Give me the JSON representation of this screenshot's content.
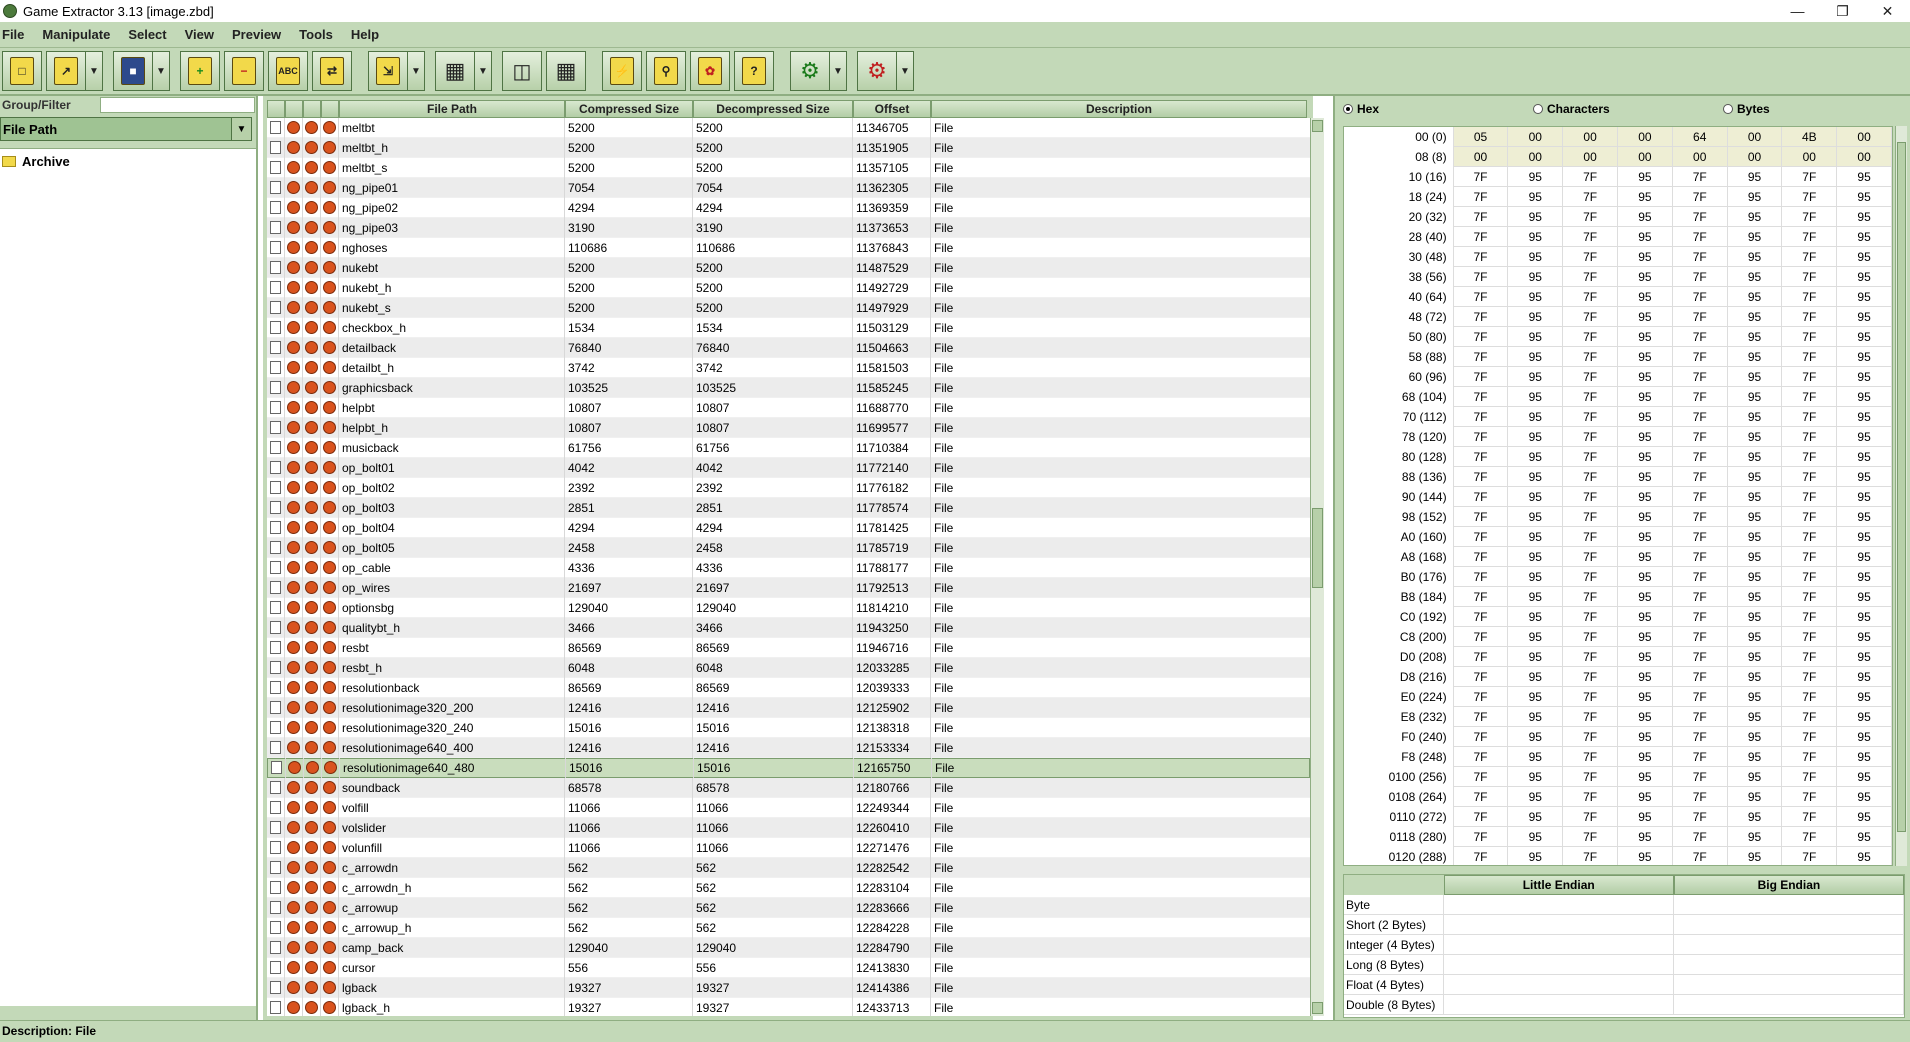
{
  "window": {
    "title": "Game Extractor 3.13 [image.zbd]"
  },
  "menu": [
    "File",
    "Manipulate",
    "Select",
    "View",
    "Preview",
    "Tools",
    "Help"
  ],
  "toolbar_icons": [
    "new-archive-icon",
    "open-archive-icon",
    "save-archive-icon",
    "add-files-icon",
    "remove-files-icon",
    "rename-files-icon",
    "write-archive-icon",
    "extract-icon",
    "table-view-icon",
    "thumbnail-view-icon",
    "details-view-icon",
    "scripts-icon",
    "search-icon",
    "plugins-icon",
    "help-icon",
    "tools-icon",
    "options-icon"
  ],
  "filter": {
    "label": "Group/Filter Type",
    "value": "File Path"
  },
  "tree": {
    "root": "Archive"
  },
  "table": {
    "columns": {
      "path": "File Path",
      "compressed": "Compressed Size",
      "decompressed": "Decompressed Size",
      "offset": "Offset",
      "description": "Description"
    },
    "rows": [
      [
        "meltbt",
        "5200",
        "5200",
        "11346705",
        "File"
      ],
      [
        "meltbt_h",
        "5200",
        "5200",
        "11351905",
        "File"
      ],
      [
        "meltbt_s",
        "5200",
        "5200",
        "11357105",
        "File"
      ],
      [
        "ng_pipe01",
        "7054",
        "7054",
        "11362305",
        "File"
      ],
      [
        "ng_pipe02",
        "4294",
        "4294",
        "11369359",
        "File"
      ],
      [
        "ng_pipe03",
        "3190",
        "3190",
        "11373653",
        "File"
      ],
      [
        "nghoses",
        "110686",
        "110686",
        "11376843",
        "File"
      ],
      [
        "nukebt",
        "5200",
        "5200",
        "11487529",
        "File"
      ],
      [
        "nukebt_h",
        "5200",
        "5200",
        "11492729",
        "File"
      ],
      [
        "nukebt_s",
        "5200",
        "5200",
        "11497929",
        "File"
      ],
      [
        "checkbox_h",
        "1534",
        "1534",
        "11503129",
        "File"
      ],
      [
        "detailback",
        "76840",
        "76840",
        "11504663",
        "File"
      ],
      [
        "detailbt_h",
        "3742",
        "3742",
        "11581503",
        "File"
      ],
      [
        "graphicsback",
        "103525",
        "103525",
        "11585245",
        "File"
      ],
      [
        "helpbt",
        "10807",
        "10807",
        "11688770",
        "File"
      ],
      [
        "helpbt_h",
        "10807",
        "10807",
        "11699577",
        "File"
      ],
      [
        "musicback",
        "61756",
        "61756",
        "11710384",
        "File"
      ],
      [
        "op_bolt01",
        "4042",
        "4042",
        "11772140",
        "File"
      ],
      [
        "op_bolt02",
        "2392",
        "2392",
        "11776182",
        "File"
      ],
      [
        "op_bolt03",
        "2851",
        "2851",
        "11778574",
        "File"
      ],
      [
        "op_bolt04",
        "4294",
        "4294",
        "11781425",
        "File"
      ],
      [
        "op_bolt05",
        "2458",
        "2458",
        "11785719",
        "File"
      ],
      [
        "op_cable",
        "4336",
        "4336",
        "11788177",
        "File"
      ],
      [
        "op_wires",
        "21697",
        "21697",
        "11792513",
        "File"
      ],
      [
        "optionsbg",
        "129040",
        "129040",
        "11814210",
        "File"
      ],
      [
        "qualitybt_h",
        "3466",
        "3466",
        "11943250",
        "File"
      ],
      [
        "resbt",
        "86569",
        "86569",
        "11946716",
        "File"
      ],
      [
        "resbt_h",
        "6048",
        "6048",
        "12033285",
        "File"
      ],
      [
        "resolutionback",
        "86569",
        "86569",
        "12039333",
        "File"
      ],
      [
        "resolutionimage320_200",
        "12416",
        "12416",
        "12125902",
        "File"
      ],
      [
        "resolutionimage320_240",
        "15016",
        "15016",
        "12138318",
        "File"
      ],
      [
        "resolutionimage640_400",
        "12416",
        "12416",
        "12153334",
        "File"
      ],
      [
        "resolutionimage640_480",
        "15016",
        "15016",
        "12165750",
        "File"
      ],
      [
        "soundback",
        "68578",
        "68578",
        "12180766",
        "File"
      ],
      [
        "volfill",
        "11066",
        "11066",
        "12249344",
        "File"
      ],
      [
        "volslider",
        "11066",
        "11066",
        "12260410",
        "File"
      ],
      [
        "volunfill",
        "11066",
        "11066",
        "12271476",
        "File"
      ],
      [
        "c_arrowdn",
        "562",
        "562",
        "12282542",
        "File"
      ],
      [
        "c_arrowdn_h",
        "562",
        "562",
        "12283104",
        "File"
      ],
      [
        "c_arrowup",
        "562",
        "562",
        "12283666",
        "File"
      ],
      [
        "c_arrowup_h",
        "562",
        "562",
        "12284228",
        "File"
      ],
      [
        "camp_back",
        "129040",
        "129040",
        "12284790",
        "File"
      ],
      [
        "cursor",
        "556",
        "556",
        "12413830",
        "File"
      ],
      [
        "lgback",
        "19327",
        "19327",
        "12414386",
        "File"
      ],
      [
        "lgback_h",
        "19327",
        "19327",
        "12433713",
        "File"
      ]
    ],
    "selected_index": 32
  },
  "hex": {
    "modes": [
      "Hex",
      "Characters",
      "Bytes"
    ],
    "selected_mode": "Hex",
    "rows": [
      [
        "00 (0)",
        [
          "05",
          "00",
          "00",
          "00",
          "64",
          "00",
          "4B",
          "00"
        ]
      ],
      [
        "08 (8)",
        [
          "00",
          "00",
          "00",
          "00",
          "00",
          "00",
          "00",
          "00"
        ]
      ],
      [
        "10 (16)",
        [
          "7F",
          "95",
          "7F",
          "95",
          "7F",
          "95",
          "7F",
          "95"
        ]
      ],
      [
        "18 (24)",
        [
          "7F",
          "95",
          "7F",
          "95",
          "7F",
          "95",
          "7F",
          "95"
        ]
      ],
      [
        "20 (32)",
        [
          "7F",
          "95",
          "7F",
          "95",
          "7F",
          "95",
          "7F",
          "95"
        ]
      ],
      [
        "28 (40)",
        [
          "7F",
          "95",
          "7F",
          "95",
          "7F",
          "95",
          "7F",
          "95"
        ]
      ],
      [
        "30 (48)",
        [
          "7F",
          "95",
          "7F",
          "95",
          "7F",
          "95",
          "7F",
          "95"
        ]
      ],
      [
        "38 (56)",
        [
          "7F",
          "95",
          "7F",
          "95",
          "7F",
          "95",
          "7F",
          "95"
        ]
      ],
      [
        "40 (64)",
        [
          "7F",
          "95",
          "7F",
          "95",
          "7F",
          "95",
          "7F",
          "95"
        ]
      ],
      [
        "48 (72)",
        [
          "7F",
          "95",
          "7F",
          "95",
          "7F",
          "95",
          "7F",
          "95"
        ]
      ],
      [
        "50 (80)",
        [
          "7F",
          "95",
          "7F",
          "95",
          "7F",
          "95",
          "7F",
          "95"
        ]
      ],
      [
        "58 (88)",
        [
          "7F",
          "95",
          "7F",
          "95",
          "7F",
          "95",
          "7F",
          "95"
        ]
      ],
      [
        "60 (96)",
        [
          "7F",
          "95",
          "7F",
          "95",
          "7F",
          "95",
          "7F",
          "95"
        ]
      ],
      [
        "68 (104)",
        [
          "7F",
          "95",
          "7F",
          "95",
          "7F",
          "95",
          "7F",
          "95"
        ]
      ],
      [
        "70 (112)",
        [
          "7F",
          "95",
          "7F",
          "95",
          "7F",
          "95",
          "7F",
          "95"
        ]
      ],
      [
        "78 (120)",
        [
          "7F",
          "95",
          "7F",
          "95",
          "7F",
          "95",
          "7F",
          "95"
        ]
      ],
      [
        "80 (128)",
        [
          "7F",
          "95",
          "7F",
          "95",
          "7F",
          "95",
          "7F",
          "95"
        ]
      ],
      [
        "88 (136)",
        [
          "7F",
          "95",
          "7F",
          "95",
          "7F",
          "95",
          "7F",
          "95"
        ]
      ],
      [
        "90 (144)",
        [
          "7F",
          "95",
          "7F",
          "95",
          "7F",
          "95",
          "7F",
          "95"
        ]
      ],
      [
        "98 (152)",
        [
          "7F",
          "95",
          "7F",
          "95",
          "7F",
          "95",
          "7F",
          "95"
        ]
      ],
      [
        "A0 (160)",
        [
          "7F",
          "95",
          "7F",
          "95",
          "7F",
          "95",
          "7F",
          "95"
        ]
      ],
      [
        "A8 (168)",
        [
          "7F",
          "95",
          "7F",
          "95",
          "7F",
          "95",
          "7F",
          "95"
        ]
      ],
      [
        "B0 (176)",
        [
          "7F",
          "95",
          "7F",
          "95",
          "7F",
          "95",
          "7F",
          "95"
        ]
      ],
      [
        "B8 (184)",
        [
          "7F",
          "95",
          "7F",
          "95",
          "7F",
          "95",
          "7F",
          "95"
        ]
      ],
      [
        "C0 (192)",
        [
          "7F",
          "95",
          "7F",
          "95",
          "7F",
          "95",
          "7F",
          "95"
        ]
      ],
      [
        "C8 (200)",
        [
          "7F",
          "95",
          "7F",
          "95",
          "7F",
          "95",
          "7F",
          "95"
        ]
      ],
      [
        "D0 (208)",
        [
          "7F",
          "95",
          "7F",
          "95",
          "7F",
          "95",
          "7F",
          "95"
        ]
      ],
      [
        "D8 (216)",
        [
          "7F",
          "95",
          "7F",
          "95",
          "7F",
          "95",
          "7F",
          "95"
        ]
      ],
      [
        "E0 (224)",
        [
          "7F",
          "95",
          "7F",
          "95",
          "7F",
          "95",
          "7F",
          "95"
        ]
      ],
      [
        "E8 (232)",
        [
          "7F",
          "95",
          "7F",
          "95",
          "7F",
          "95",
          "7F",
          "95"
        ]
      ],
      [
        "F0 (240)",
        [
          "7F",
          "95",
          "7F",
          "95",
          "7F",
          "95",
          "7F",
          "95"
        ]
      ],
      [
        "F8 (248)",
        [
          "7F",
          "95",
          "7F",
          "95",
          "7F",
          "95",
          "7F",
          "95"
        ]
      ],
      [
        "0100 (256)",
        [
          "7F",
          "95",
          "7F",
          "95",
          "7F",
          "95",
          "7F",
          "95"
        ]
      ],
      [
        "0108 (264)",
        [
          "7F",
          "95",
          "7F",
          "95",
          "7F",
          "95",
          "7F",
          "95"
        ]
      ],
      [
        "0110 (272)",
        [
          "7F",
          "95",
          "7F",
          "95",
          "7F",
          "95",
          "7F",
          "95"
        ]
      ],
      [
        "0118 (280)",
        [
          "7F",
          "95",
          "7F",
          "95",
          "7F",
          "95",
          "7F",
          "95"
        ]
      ],
      [
        "0120 (288)",
        [
          "7F",
          "95",
          "7F",
          "95",
          "7F",
          "95",
          "7F",
          "95"
        ]
      ]
    ]
  },
  "endian": {
    "headers": [
      "Little Endian",
      "Big Endian"
    ],
    "rows": [
      "Byte",
      "Short (2 Bytes)",
      "Integer (4 Bytes)",
      "Long (8 Bytes)",
      "Float (4 Bytes)",
      "Double (8 Bytes)"
    ]
  },
  "status": {
    "text": "Description: File"
  },
  "colors": {
    "theme": "#c3d9b8",
    "selected_row": "#c9ddbd",
    "highlight_hex": "#eeeed4"
  }
}
